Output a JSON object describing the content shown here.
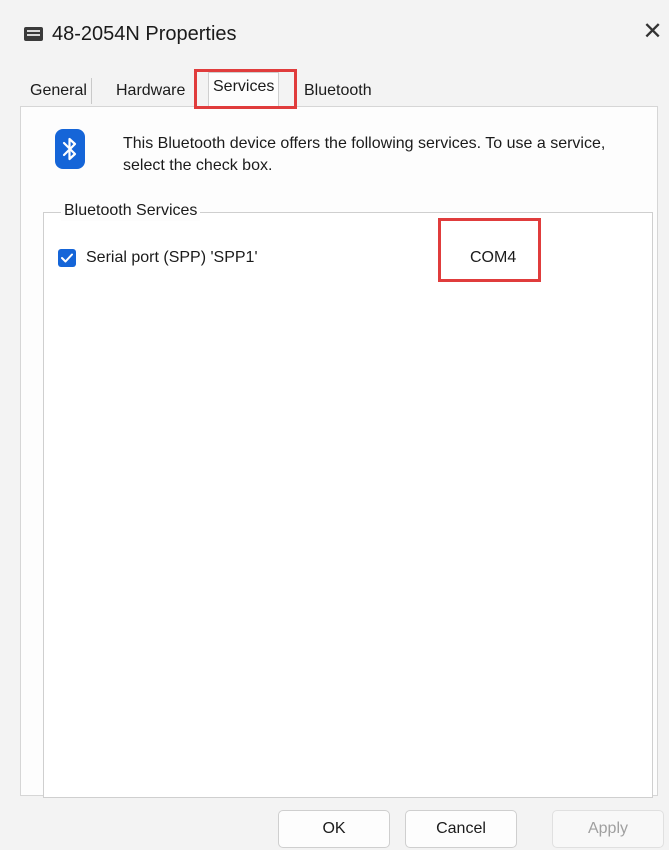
{
  "window": {
    "title": "48-2054N Properties",
    "close_glyph": "✕",
    "icon": "device-icon"
  },
  "tabs": [
    {
      "label": "General"
    },
    {
      "label": "Hardware"
    },
    {
      "label": "Services",
      "active": true
    },
    {
      "label": "Bluetooth"
    }
  ],
  "services_page": {
    "icon": "bluetooth-icon",
    "intro_text": "This Bluetooth device offers the following services. To use a service, select the check box.",
    "group_label": "Bluetooth Services",
    "services": [
      {
        "name": "Serial port (SPP) 'SPP1'",
        "port": "COM4",
        "checked": true
      }
    ]
  },
  "buttons": {
    "ok": "OK",
    "cancel": "Cancel",
    "apply": "Apply",
    "apply_enabled": false
  },
  "colors": {
    "accent": "#1565d8",
    "highlight": "#e03c3c"
  }
}
